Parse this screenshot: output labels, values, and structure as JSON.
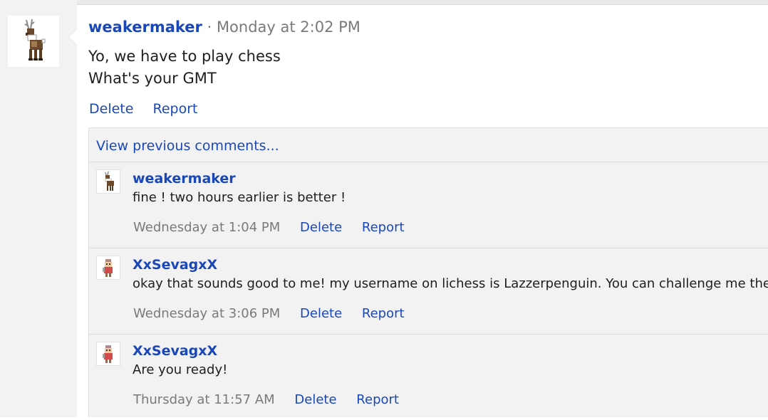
{
  "post": {
    "author": "weakermaker",
    "separator": "·",
    "time": "Monday at 2:02 PM",
    "lines": [
      "Yo, we have to play chess",
      "What's your GMT"
    ],
    "actions": {
      "delete": "Delete",
      "report": "Report"
    },
    "avatar_icon": "reindeer-avatar-icon"
  },
  "comments_panel": {
    "view_previous": "View previous comments...",
    "items": [
      {
        "author": "weakermaker",
        "text": "fine ! two hours earlier is better !",
        "time": "Wednesday at 1:04 PM",
        "delete": "Delete",
        "report": "Report",
        "avatar_icon": "reindeer-avatar-icon"
      },
      {
        "author": "XxSevagxX",
        "text": "okay that sounds good to me! my username on lichess is Lazzerpenguin. You can challenge me then :)",
        "time": "Wednesday at 3:06 PM",
        "delete": "Delete",
        "report": "Report",
        "avatar_icon": "pixel-character-avatar-icon"
      },
      {
        "author": "XxSevagxX",
        "text": "Are you ready!",
        "time": "Thursday at 11:57 AM",
        "delete": "Delete",
        "report": "Report",
        "avatar_icon": "pixel-character-avatar-icon"
      }
    ]
  },
  "colors": {
    "link": "#1a47b8",
    "muted": "#7a7a7a",
    "panel_bg": "#f2f2f2"
  }
}
